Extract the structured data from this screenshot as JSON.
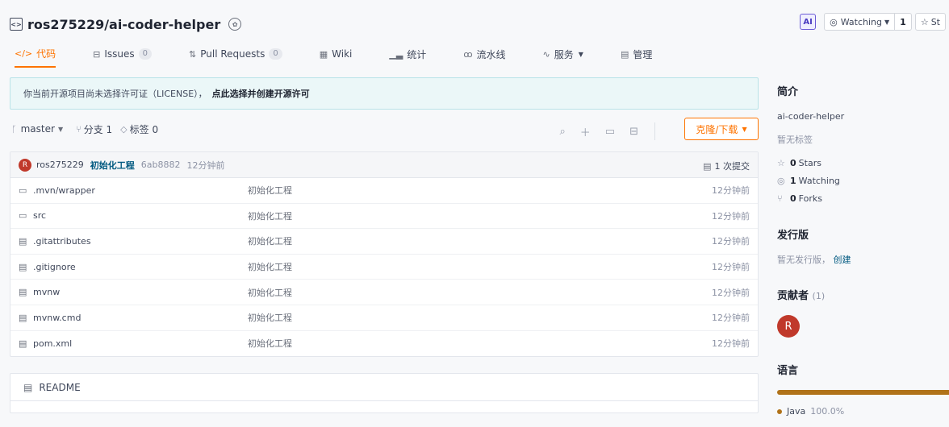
{
  "repo": {
    "full_name": "ros275229/ai-coder-helper"
  },
  "top_actions": {
    "ai_label": "AI",
    "watch_label": "Watching",
    "watch_count": "1",
    "star_label": "St"
  },
  "tabs": [
    {
      "label": "代码",
      "icon": "code-icon"
    },
    {
      "label": "Issues",
      "count": "0",
      "icon": "issues-icon"
    },
    {
      "label": "Pull Requests",
      "count": "0",
      "icon": "pull-request-icon"
    },
    {
      "label": "Wiki",
      "icon": "wiki-icon"
    },
    {
      "label": "统计",
      "icon": "chart-icon"
    },
    {
      "label": "流水线",
      "icon": "pipeline-icon"
    },
    {
      "label": "服务",
      "icon": "service-icon"
    },
    {
      "label": "管理",
      "icon": "manage-icon"
    }
  ],
  "notice": {
    "text": "你当前开源项目尚未选择许可证（LICENSE），",
    "link": "点此选择并创建开源许可"
  },
  "branch_bar": {
    "branch": "master",
    "branches": "分支 1",
    "tags": "标签 0",
    "clone_label": "克隆/下载"
  },
  "commit": {
    "avatar_letter": "R",
    "author": "ros275229",
    "message": "初始化工程",
    "hash": "6ab8882",
    "time": "12分钟前",
    "count_label": "1 次提交"
  },
  "files": [
    {
      "name": ".mvn/wrapper",
      "type": "folder",
      "message": "初始化工程",
      "time": "12分钟前"
    },
    {
      "name": "src",
      "type": "folder",
      "message": "初始化工程",
      "time": "12分钟前"
    },
    {
      "name": ".gitattributes",
      "type": "file",
      "message": "初始化工程",
      "time": "12分钟前"
    },
    {
      "name": ".gitignore",
      "type": "file",
      "message": "初始化工程",
      "time": "12分钟前"
    },
    {
      "name": "mvnw",
      "type": "file",
      "message": "初始化工程",
      "time": "12分钟前"
    },
    {
      "name": "mvnw.cmd",
      "type": "file",
      "message": "初始化工程",
      "time": "12分钟前"
    },
    {
      "name": "pom.xml",
      "type": "file",
      "message": "初始化工程",
      "time": "12分钟前"
    }
  ],
  "readme": {
    "title": "README"
  },
  "sidebar": {
    "intro_title": "简介",
    "description": "ai-coder-helper",
    "no_tags": "暂无标签",
    "stars_count": "0",
    "stars_label": "Stars",
    "watching_count": "1",
    "watching_label": "Watching",
    "forks_count": "0",
    "forks_label": "Forks",
    "releases_title": "发行版",
    "no_releases": "暂无发行版，",
    "create_link": "创建",
    "contributors_title": "贡献者",
    "contributors_count": "(1)",
    "contributor_letter": "R",
    "languages_title": "语言",
    "language_name": "Java",
    "language_pct": "100.0%",
    "language_fraction": 1.0,
    "language_color": "#b07219"
  },
  "colors": {
    "accent": "#fe7300",
    "link": "#005980"
  }
}
